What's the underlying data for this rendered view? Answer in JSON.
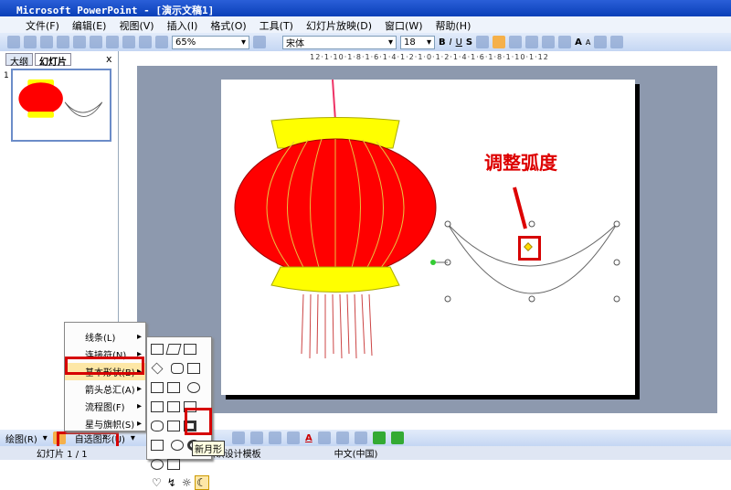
{
  "window": {
    "title": "Microsoft PowerPoint - [演示文稿1]"
  },
  "menu": [
    "文件(F)",
    "编辑(E)",
    "视图(V)",
    "插入(I)",
    "格式(O)",
    "工具(T)",
    "幻灯片放映(D)",
    "窗口(W)",
    "帮助(H)"
  ],
  "toolbar": {
    "zoom": "65%",
    "font": "宋体",
    "size": "18",
    "bold": "B",
    "italic": "I",
    "underline": "U",
    "shadow": "S",
    "grow": "A",
    "shrink": "A"
  },
  "panel": {
    "tab_outline": "大纲",
    "tab_slides": "幻灯片",
    "close": "x",
    "slide_number": "1"
  },
  "ruler": "12·1·10·1·8·1·6·1·4·1·2·1·0·1·2·1·4·1·6·1·8·1·10·1·12",
  "slide": {
    "annotation": "调整弧度"
  },
  "autoshape_menu": {
    "items": [
      "线条(L)",
      "连接符(N)",
      "基本形状(B)",
      "箭头总汇(A)",
      "流程图(F)",
      "星与旗帜(S)"
    ],
    "more": "»"
  },
  "tooltip": "新月形",
  "drawbar": {
    "draw": "绘图(R)",
    "autoshapes": "自选图形(U)"
  },
  "status": {
    "slide": "幻灯片 1 / 1",
    "template": "默认设计模板",
    "language": "中文(中国)"
  }
}
